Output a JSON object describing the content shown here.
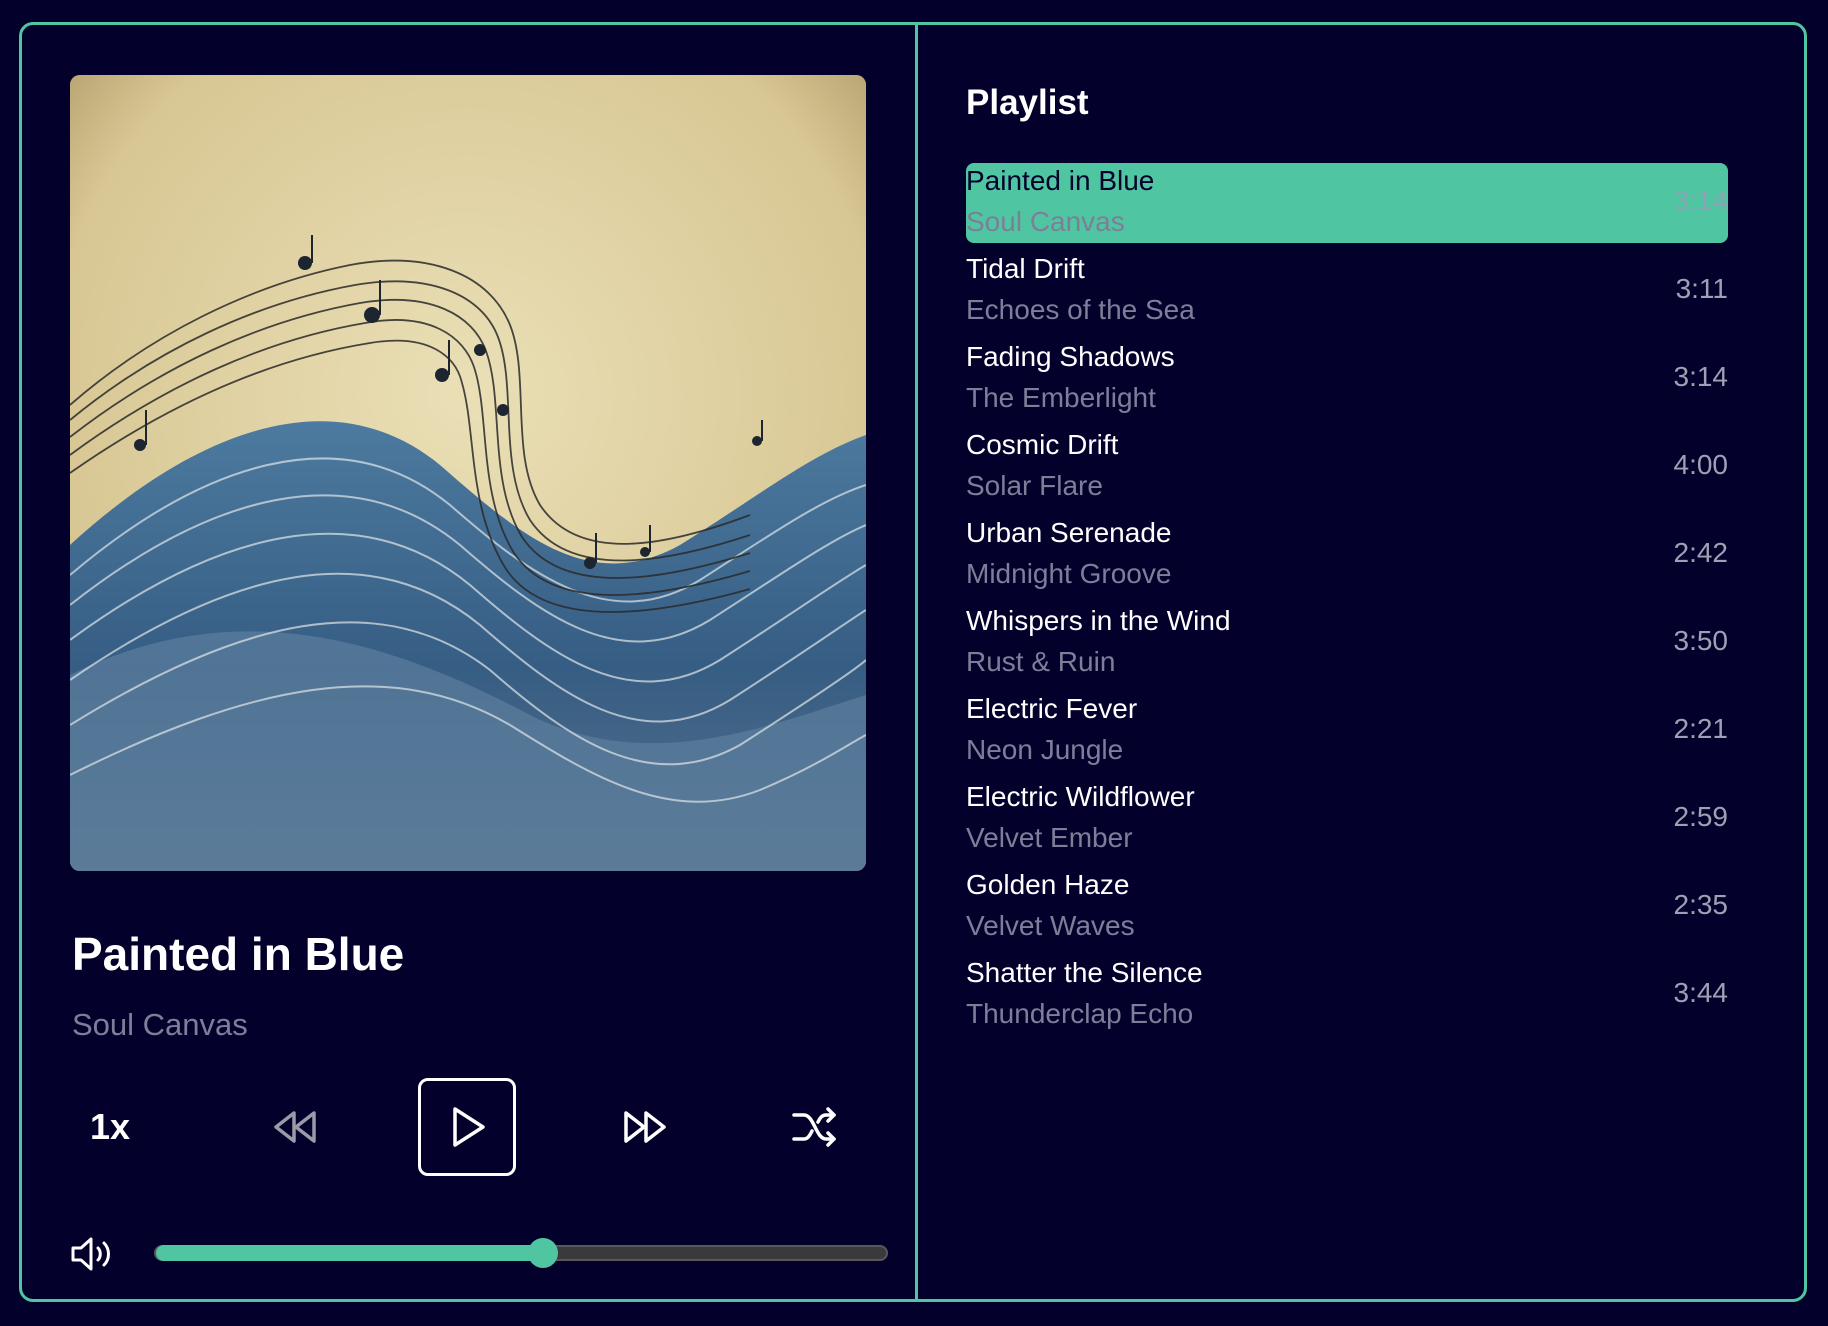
{
  "now_playing": {
    "title": "Painted in Blue",
    "artist": "Soul Canvas",
    "cover_icon": "sheet-music-wave-artwork"
  },
  "controls": {
    "speed_label": "1x",
    "rewind_icon": "rewind-icon",
    "play_icon": "play-icon",
    "forward_icon": "fast-forward-icon",
    "shuffle_icon": "shuffle-icon"
  },
  "volume": {
    "icon": "volume-icon",
    "level": 0.53
  },
  "playlist": {
    "heading": "Playlist",
    "active_index": 0,
    "items": [
      {
        "title": "Painted in Blue",
        "artist": "Soul Canvas",
        "duration": "3:14"
      },
      {
        "title": "Tidal Drift",
        "artist": "Echoes of the Sea",
        "duration": "3:11"
      },
      {
        "title": "Fading Shadows",
        "artist": "The Emberlight",
        "duration": "3:14"
      },
      {
        "title": "Cosmic Drift",
        "artist": "Solar Flare",
        "duration": "4:00"
      },
      {
        "title": "Urban Serenade",
        "artist": "Midnight Groove",
        "duration": "2:42"
      },
      {
        "title": "Whispers in the Wind",
        "artist": "Rust & Ruin",
        "duration": "3:50"
      },
      {
        "title": "Electric Fever",
        "artist": "Neon Jungle",
        "duration": "2:21"
      },
      {
        "title": "Electric Wildflower",
        "artist": "Velvet Ember",
        "duration": "2:59"
      },
      {
        "title": "Golden Haze",
        "artist": "Velvet Waves",
        "duration": "2:35"
      },
      {
        "title": "Shatter the Silence",
        "artist": "Thunderclap Echo",
        "duration": "3:44"
      }
    ]
  },
  "colors": {
    "background": "#03012c",
    "accent": "#4fc6a1",
    "muted_text": "#7d7f99"
  }
}
